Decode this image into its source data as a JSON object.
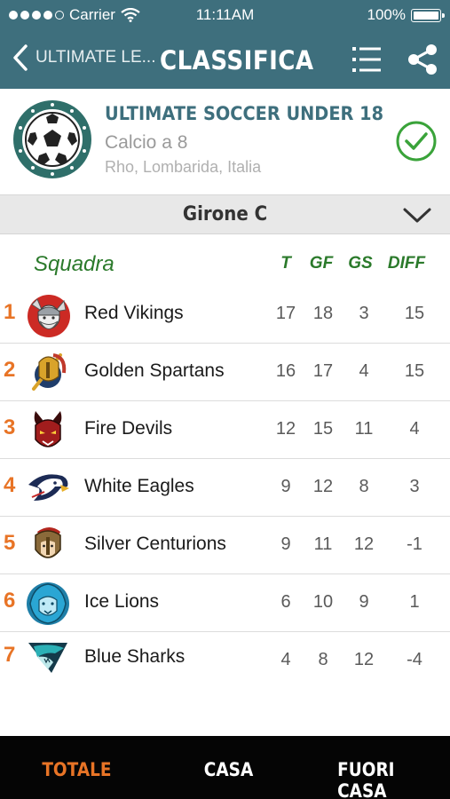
{
  "status_bar": {
    "carrier": "Carrier",
    "time": "11:11AM",
    "battery": "100%"
  },
  "nav": {
    "back_label": "ULTIMATE LE...",
    "title": "CLASSIFICA"
  },
  "tournament": {
    "name": "ULTIMATE SOCCER UNDER 18",
    "type": "Calcio a 8",
    "location": "Rho, Lombarida, Italia"
  },
  "group": {
    "label": "Girone C"
  },
  "table": {
    "headers": {
      "team": "Squadra",
      "t": "T",
      "gf": "GF",
      "gs": "GS",
      "diff": "DIFF"
    },
    "rows": [
      {
        "rank": "1",
        "team": "Red Vikings",
        "t": "17",
        "gf": "18",
        "gs": "3",
        "diff": "15",
        "crest": "viking-crest-icon"
      },
      {
        "rank": "2",
        "team": "Golden Spartans",
        "t": "16",
        "gf": "17",
        "gs": "4",
        "diff": "15",
        "crest": "spartan-crest-icon"
      },
      {
        "rank": "3",
        "team": "Fire Devils",
        "t": "12",
        "gf": "15",
        "gs": "11",
        "diff": "4",
        "crest": "devil-crest-icon"
      },
      {
        "rank": "4",
        "team": "White Eagles",
        "t": "9",
        "gf": "12",
        "gs": "8",
        "diff": "3",
        "crest": "eagle-crest-icon"
      },
      {
        "rank": "5",
        "team": "Silver Centurions",
        "t": "9",
        "gf": "11",
        "gs": "12",
        "diff": "-1",
        "crest": "centurion-crest-icon"
      },
      {
        "rank": "6",
        "team": "Ice Lions",
        "t": "6",
        "gf": "10",
        "gs": "9",
        "diff": "1",
        "crest": "lion-crest-icon"
      },
      {
        "rank": "7",
        "team": "Blue Sharks",
        "t": "4",
        "gf": "8",
        "gs": "12",
        "diff": "-4",
        "crest": "shark-crest-icon"
      }
    ]
  },
  "tabs": [
    {
      "label": "TOTALE",
      "active": true
    },
    {
      "label": "CASA",
      "active": false
    },
    {
      "label": "FUORI CASA",
      "active": false
    }
  ],
  "colors": {
    "nav_bg": "#3e6f7d",
    "rank_orange": "#e87426",
    "header_green": "#2b7a2b",
    "check_green": "#3aa33a",
    "tabbar_bg": "#050505"
  }
}
